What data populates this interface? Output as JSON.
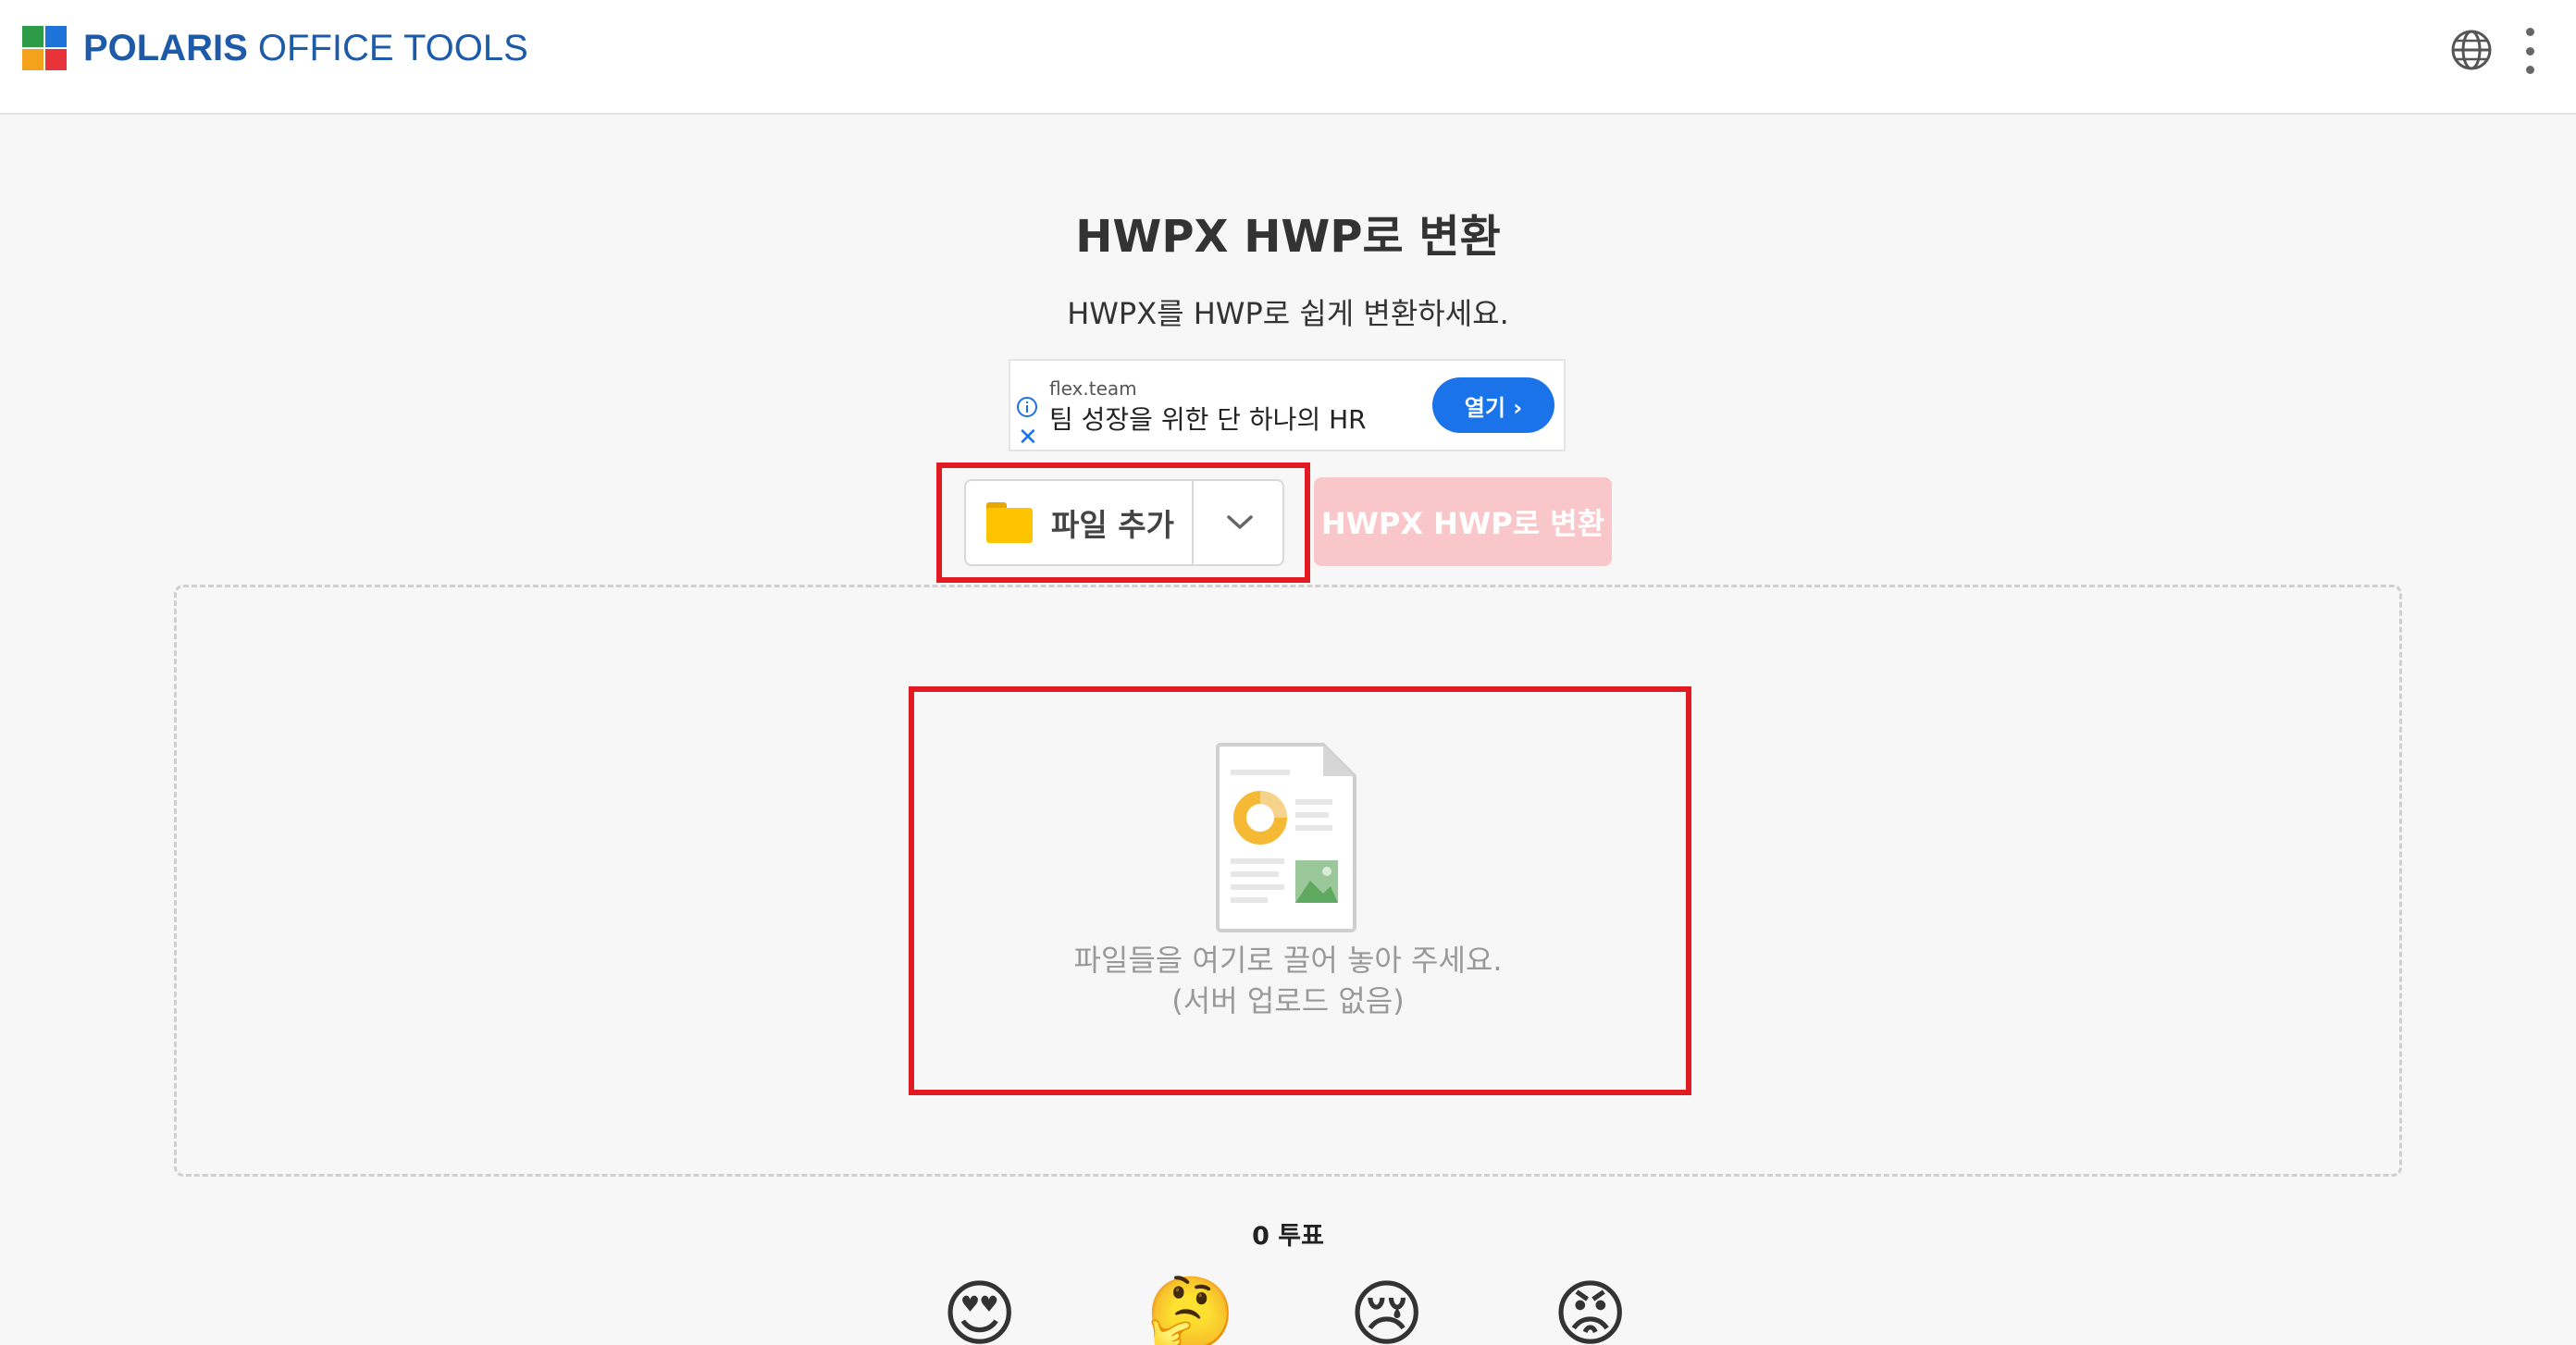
{
  "header": {
    "logo_bold": "POLARIS",
    "logo_light": "OFFICE TOOLS",
    "icons": [
      "globe-icon",
      "more-vertical-icon"
    ]
  },
  "main": {
    "title": "HWPX HWP로 변환",
    "subtitle": "HWPX를 HWP로 쉽게 변환하세요."
  },
  "ad": {
    "domain": "flex.team",
    "text": "팀 성장을 위한 단 하나의 HR",
    "button": "열기 ›",
    "close": "✕"
  },
  "toolbar": {
    "add_file_label": "파일 추가",
    "convert_label": "HWPX HWP로 변환"
  },
  "dropzone": {
    "line1": "파일들을 여기로 끌어 놓아 주세요.",
    "line2": "(서버 업로드 없음)"
  },
  "feedback": {
    "votes": "0 투표",
    "emojis": [
      "😍",
      "🤔",
      "😢",
      "😡"
    ]
  },
  "colors": {
    "accent_blue": "#1a73e8",
    "highlight_red": "#e01b22",
    "convert_disabled": "#f9c7c9",
    "brand_blue": "#1d5aa8"
  }
}
